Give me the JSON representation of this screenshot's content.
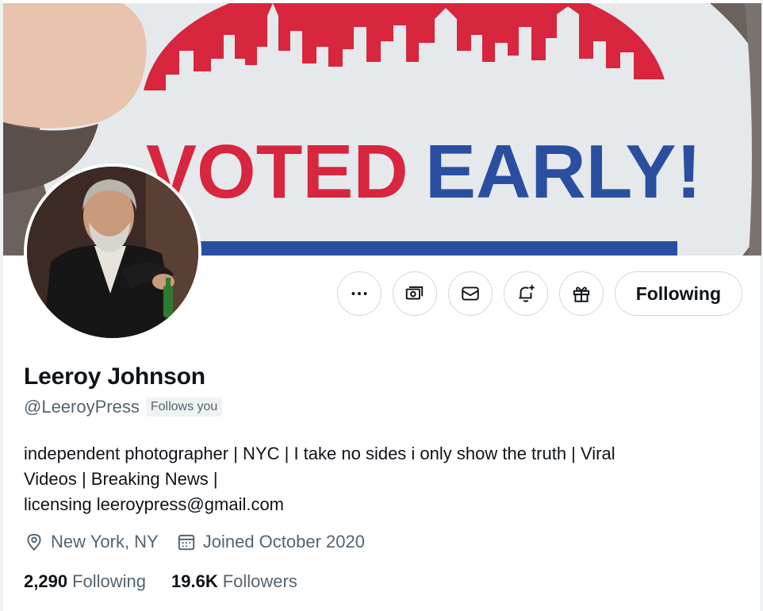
{
  "banner": {
    "sticker_word_1": "VOTED",
    "sticker_word_2": "EARLY!",
    "colors": {
      "red": "#d7263d",
      "blue": "#2a4fa0",
      "paper": "#e9ecef"
    }
  },
  "profile": {
    "display_name": "Leeroy Johnson",
    "handle": "@LeeroyPress",
    "follows_you_label": "Follows you",
    "bio_lines": [
      "independent photographer | NYC |  I take no sides i only show the truth | Viral",
      "Videos | Breaking News |",
      "licensing leeroypress@gmail.com"
    ],
    "location": "New York, NY",
    "joined": "Joined October 2020",
    "following_count": "2,290",
    "following_label": "Following",
    "followers_count": "19.6K",
    "followers_label": "Followers"
  },
  "actions": {
    "buttons": [
      {
        "icon": "more-icon"
      },
      {
        "icon": "money-icon"
      },
      {
        "icon": "mail-icon"
      },
      {
        "icon": "notification-bell-icon"
      },
      {
        "icon": "gift-icon"
      }
    ],
    "follow_state_label": "Following"
  },
  "colors": {
    "text_primary": "#0f1419",
    "text_secondary": "#536471",
    "border": "#cfd9de",
    "badge_bg": "#eff3f4"
  }
}
